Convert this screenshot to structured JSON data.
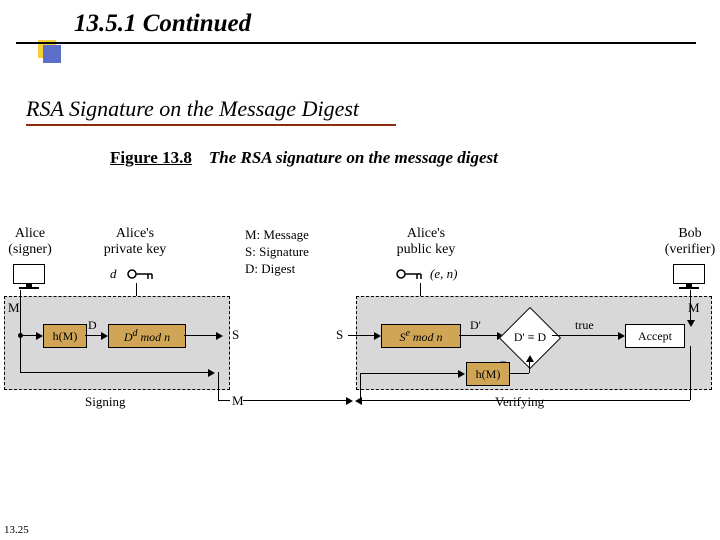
{
  "header": {
    "title": "13.5.1  Continued",
    "subtitle": "RSA Signature on the Message Digest",
    "figure_label": "Figure 13.8",
    "figure_caption": "The RSA signature on the message digest"
  },
  "footer": {
    "slide_number": "13.25"
  },
  "diagram": {
    "signer": {
      "role_name": "Alice",
      "role_desc": "(signer)",
      "key_label": "Alice's\nprivate key",
      "key_value": "d",
      "caption": "Signing",
      "input_letter": "M",
      "hash_label": "h(M)",
      "digest_letter": "D",
      "sign_expr": "D",
      "sign_exp": "d",
      "sign_mod": " mod n",
      "output_letter": "S",
      "feedback_letter": "M"
    },
    "legend": {
      "line1": "M: Message",
      "line2": "S: Signature",
      "line3": "D: Digest"
    },
    "verifier": {
      "role_name": "Bob",
      "role_desc": "(verifier)",
      "key_label": "Alice's\npublic key",
      "key_value": "(e, n)",
      "caption": "Verifying",
      "input_letter": "S",
      "verify_base": "S",
      "verify_exp": "e",
      "verify_mod": " mod n",
      "dprime": "D'",
      "compare": "D' ≡ D",
      "true_label": "true",
      "accept": "Accept",
      "msg_in": "M",
      "hash_label": "h(M)",
      "digest_letter": "D"
    }
  }
}
